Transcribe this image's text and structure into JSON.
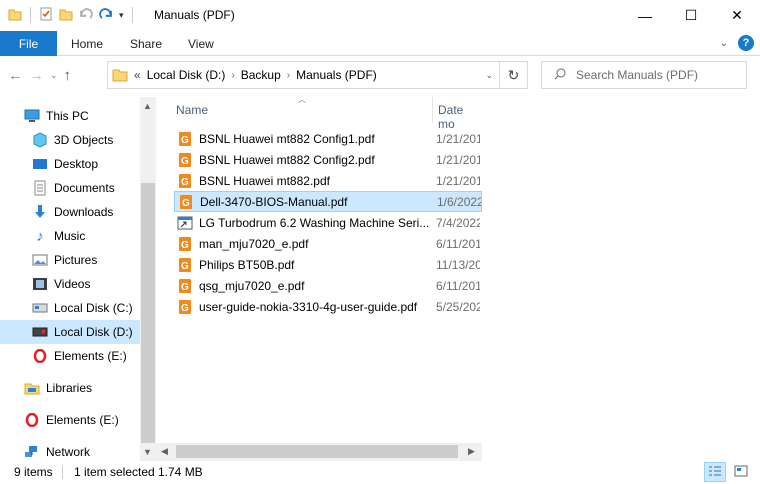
{
  "window": {
    "title": "Manuals (PDF)",
    "controls": {
      "minimize": "—",
      "maximize": "☐",
      "close": "✕"
    }
  },
  "ribbon": {
    "file": "File",
    "tabs": [
      "Home",
      "Share",
      "View"
    ]
  },
  "address": {
    "overflow": "«",
    "crumbs": [
      "Local Disk (D:)",
      "Backup",
      "Manuals (PDF)"
    ]
  },
  "search": {
    "placeholder": "Search Manuals (PDF)"
  },
  "nav": [
    {
      "label": "This PC",
      "icon": "computer-icon"
    },
    {
      "label": "3D Objects",
      "icon": "cube-icon"
    },
    {
      "label": "Desktop",
      "icon": "desktop-icon"
    },
    {
      "label": "Documents",
      "icon": "document-icon"
    },
    {
      "label": "Downloads",
      "icon": "download-icon"
    },
    {
      "label": "Music",
      "icon": "music-icon"
    },
    {
      "label": "Pictures",
      "icon": "pictures-icon"
    },
    {
      "label": "Videos",
      "icon": "video-icon"
    },
    {
      "label": "Local Disk (C:)",
      "icon": "disk-icon"
    },
    {
      "label": "Local Disk (D:)",
      "icon": "disk-icon",
      "selected": true
    },
    {
      "label": "Elements (E:)",
      "icon": "opera-icon"
    },
    {
      "label": "Libraries",
      "icon": "library-icon"
    },
    {
      "label": "Elements (E:)",
      "icon": "opera-icon"
    },
    {
      "label": "Network",
      "icon": "network-icon"
    }
  ],
  "columns": {
    "name": "Name",
    "date": "Date mo"
  },
  "files": [
    {
      "name": "BSNL Huawei mt882 Config1.pdf",
      "date": "1/21/201",
      "icon": "pdf-icon"
    },
    {
      "name": "BSNL Huawei mt882 Config2.pdf",
      "date": "1/21/201",
      "icon": "pdf-icon"
    },
    {
      "name": "BSNL Huawei mt882.pdf",
      "date": "1/21/201",
      "icon": "pdf-icon"
    },
    {
      "name": "Dell-3470-BIOS-Manual.pdf",
      "date": "1/6/2022",
      "icon": "pdf-icon",
      "selected": true
    },
    {
      "name": "LG Turbodrum 6.2 Washing Machine Seri...",
      "date": "7/4/2022",
      "icon": "shortcut-icon"
    },
    {
      "name": "man_mju7020_e.pdf",
      "date": "6/11/201",
      "icon": "pdf-icon"
    },
    {
      "name": "Philips BT50B.pdf",
      "date": "11/13/20",
      "icon": "pdf-icon"
    },
    {
      "name": "qsg_mju7020_e.pdf",
      "date": "6/11/201",
      "icon": "pdf-icon"
    },
    {
      "name": "user-guide-nokia-3310-4g-user-guide.pdf",
      "date": "5/25/202",
      "icon": "pdf-icon"
    }
  ],
  "status": {
    "count": "9 items",
    "selection": "1 item selected",
    "size": "1.74 MB"
  },
  "colors": {
    "accent": "#1979ca",
    "selection": "#cce8ff",
    "pdf": "#f08a1c"
  }
}
